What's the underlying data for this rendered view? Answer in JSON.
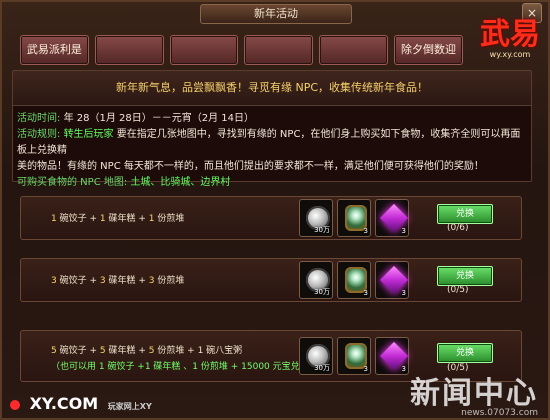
{
  "window": {
    "title": "新年活动",
    "close": "×"
  },
  "logo": {
    "main": "武易",
    "sub": "wy.xy.com"
  },
  "tabs": [
    "武易派利是",
    "",
    "",
    "",
    "",
    "除夕倒数迎"
  ],
  "banner": "新年新气息，品尝飘飘香！寻觅有缘 NPC，收集传统新年食品！",
  "info": {
    "time_label": "活动时间:",
    "time_value": "年 28（1月 28日）－－元宵（2月 14日）",
    "rules_label": "活动规则:",
    "rules_line1_prefix": "转生后玩家",
    "rules_line1_rest": "要在指定几张地图中，寻找到有缘的 NPC，在他们身上购买如下食物，收集齐全则可以再面板上兑换精",
    "rules_line2": "美的物品！有缘的 NPC 每天都不一样的，而且他们提出的要求都不一样，满足他们便可获得他们的奖励！",
    "maps_label": "可购买食物的 NPC 地图:",
    "maps_value": "土城、比骑城、边界村"
  },
  "rewards": [
    {
      "r1": "1",
      "t1": " 碗饺子 + ",
      "r2": "1",
      "t2": " 碟年糕 + ",
      "r3": "1",
      "t3": " 份煎堆",
      "line2": "",
      "icons": [
        {
          "name": "silver-coin-icon",
          "badge": "30万"
        },
        {
          "name": "emerald-icon",
          "badge": "3"
        },
        {
          "name": "purple-gem-icon",
          "badge": "3"
        }
      ],
      "button": "兑换",
      "progress": "(0/6)"
    },
    {
      "r1": "3",
      "t1": " 碗饺子 + ",
      "r2": "3",
      "t2": " 碟年糕 + ",
      "r3": "3",
      "t3": " 份煎堆",
      "line2": "",
      "icons": [
        {
          "name": "silver-coin-icon",
          "badge": "30万"
        },
        {
          "name": "emerald-icon",
          "badge": "3"
        },
        {
          "name": "purple-gem-icon",
          "badge": "3"
        }
      ],
      "button": "兑换",
      "progress": "(0/5)"
    },
    {
      "r1": "5",
      "t1": " 碗饺子 + ",
      "r2": "5",
      "t2": " 碟年糕 + ",
      "r3": "5",
      "t3": " 份煎堆 + 1 碗八宝粥",
      "line2": "（也可以用 1 碗饺子 +1 碟年糕 、1 份煎堆 + 15000 元宝兑换）",
      "icons": [
        {
          "name": "silver-coin-icon",
          "badge": "30万"
        },
        {
          "name": "emerald-icon",
          "badge": "3"
        },
        {
          "name": "purple-gem-icon",
          "badge": "3"
        }
      ],
      "button": "兑换",
      "progress": "(0/5)"
    }
  ],
  "footer": {
    "xy": "XY.COM",
    "xy_tag": "玩家网上XY"
  },
  "watermark": {
    "main": "新闻中心",
    "sub": "news.07073.com"
  },
  "colors": {
    "accent_yellow": "#f6d86b",
    "accent_green": "#62ff62",
    "tab_red": "#864a49",
    "button_green": "#2a8c2b"
  }
}
